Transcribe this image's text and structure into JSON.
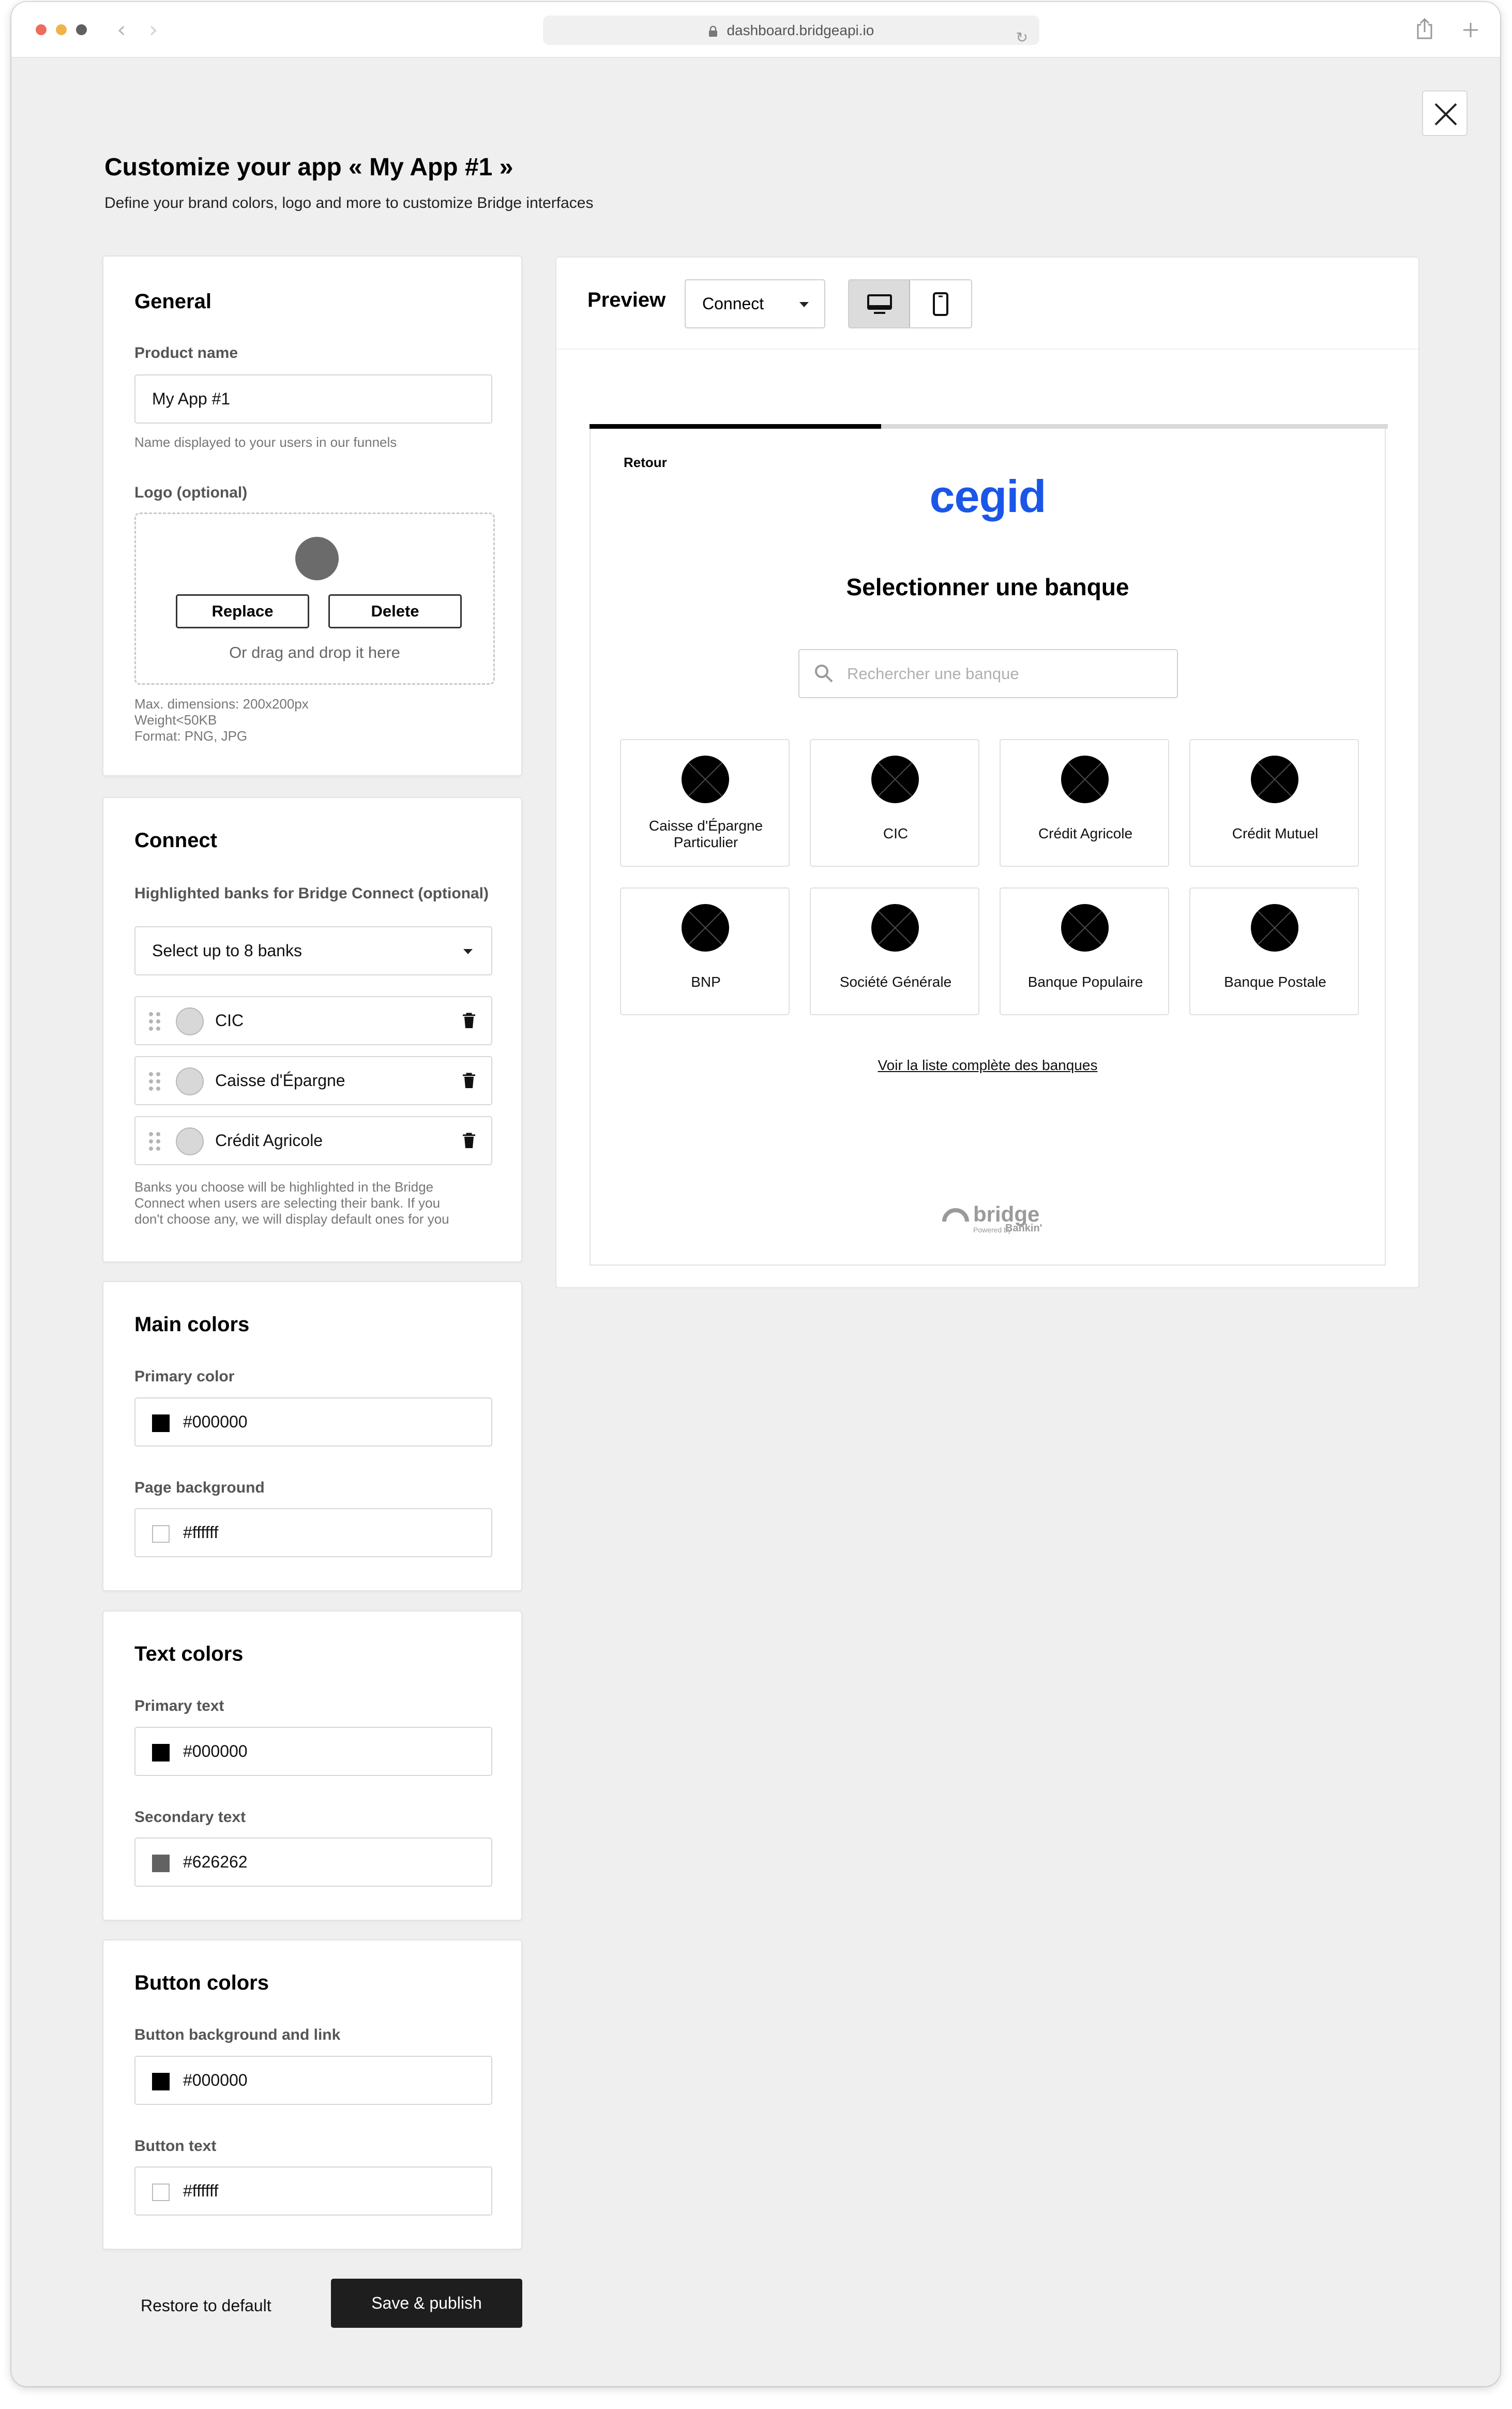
{
  "browser": {
    "url": "dashboard.bridgeapi.io",
    "traffic_lights": [
      "#ef6b5b",
      "#f0b348",
      "#606060"
    ]
  },
  "page": {
    "title": "Customize your app « My App #1 »",
    "subtitle": "Define your brand colors, logo and more to customize Bridge interfaces"
  },
  "general": {
    "title": "General",
    "product_name_label": "Product name",
    "product_name_value": "My App #1",
    "product_name_hint": "Name displayed to your users in our funnels",
    "logo_label": "Logo (optional)",
    "replace_label": "Replace",
    "delete_label": "Delete",
    "drop_text": "Or drag and drop it here",
    "logo_hint_1": "Max. dimensions: 200x200px",
    "logo_hint_2": "Weight<50KB",
    "logo_hint_3": "Format: PNG, JPG"
  },
  "connect": {
    "title": "Connect",
    "highlight_label": "Highlighted banks for Bridge Connect (optional)",
    "select_value": "Select up to 8 banks",
    "banks": [
      {
        "name": "CIC"
      },
      {
        "name": "Caisse d'Épargne"
      },
      {
        "name": "Crédit Agricole"
      }
    ],
    "hint_1": "Banks you choose will be highlighted in the Bridge",
    "hint_2": "Connect when users are selecting their bank. If you",
    "hint_3": "don't choose any, we will display default ones for you"
  },
  "main_colors": {
    "title": "Main colors",
    "primary_label": "Primary color",
    "primary_value": "#000000",
    "background_label": "Page background",
    "background_value": "#ffffff"
  },
  "text_colors": {
    "title": "Text colors",
    "primary_label": "Primary text",
    "primary_value": "#000000",
    "secondary_label": "Secondary text",
    "secondary_value": "#626262"
  },
  "button_colors": {
    "title": "Button colors",
    "background_label": "Button background and link",
    "background_value": "#000000",
    "text_label": "Button text",
    "text_value": "#ffffff"
  },
  "preview": {
    "title": "Preview",
    "mode_value": "Connect",
    "devices": [
      "desktop",
      "mobile"
    ],
    "active_device": "desktop",
    "progress_fraction": 0.365,
    "back_label": "Retour",
    "brand_name": "cegid",
    "brand_color": "#1a56e8",
    "heading": "Selectionner une banque",
    "search_placeholder": "Rechercher une banque",
    "banks": [
      {
        "name_1": "Caisse d'Épargne",
        "name_2": "Particulier"
      },
      {
        "name_1": "CIC"
      },
      {
        "name_1": "Crédit Agricole"
      },
      {
        "name_1": "Crédit Mutuel"
      },
      {
        "name_1": "BNP"
      },
      {
        "name_1": "Société Générale"
      },
      {
        "name_1": "Banque Populaire"
      },
      {
        "name_1": "Banque Postale"
      }
    ],
    "all_banks_link": "Voir la liste complète des banques",
    "footer_brand": "bridge",
    "footer_powered": "Powered by",
    "footer_bankin": "Bankin'"
  },
  "actions": {
    "restore_label": "Restore to default",
    "save_label": "Save & publish"
  }
}
